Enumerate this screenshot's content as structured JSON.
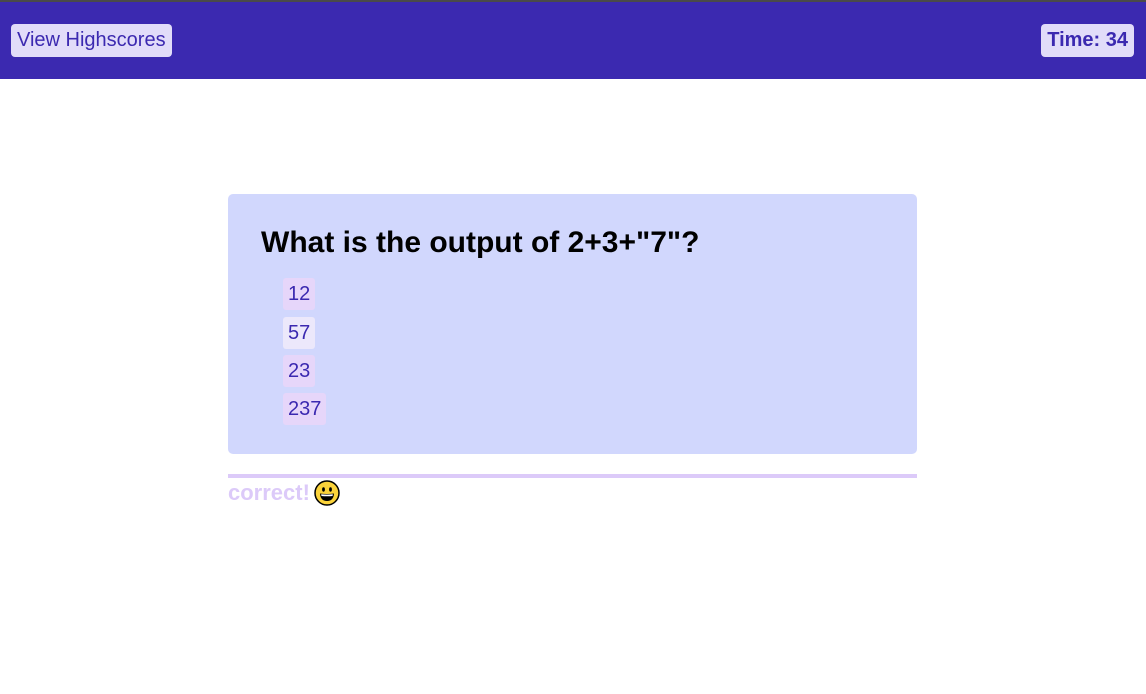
{
  "header": {
    "highscores_label": "View Highscores",
    "timer_label": "Time: 34"
  },
  "quiz": {
    "question": "What is the output of 2+3+\"7\"?",
    "choices": [
      "12",
      "57",
      "23",
      "237"
    ]
  },
  "feedback": {
    "text": "correct!",
    "icon": "grinning-face-icon"
  },
  "colors": {
    "header_bg": "#3b29b0",
    "button_bg": "#e1dcf9",
    "card_bg": "#d1d7fd",
    "choice_bg": "#e6d6fa",
    "feedback": "#dccaf9"
  }
}
